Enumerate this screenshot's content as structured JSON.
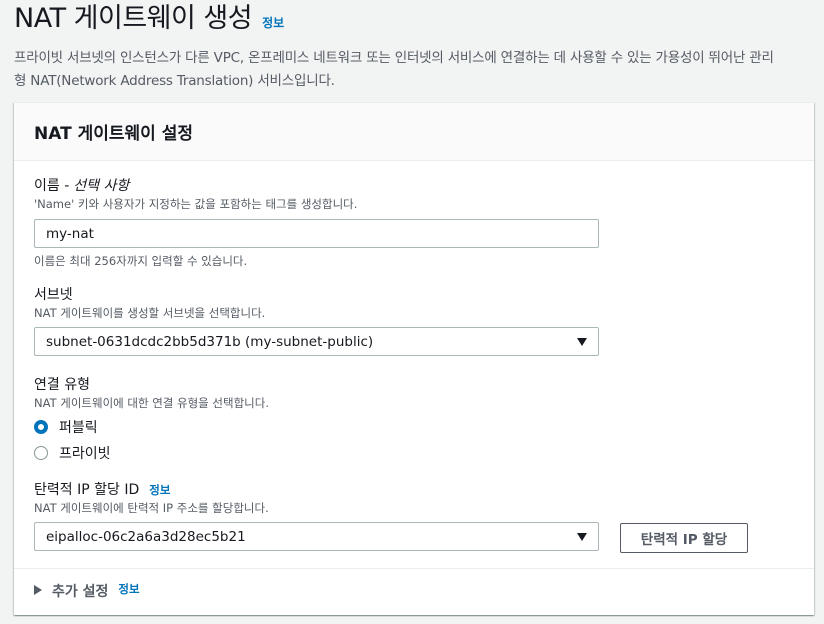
{
  "page": {
    "title": "NAT 게이트웨이 생성",
    "info": "정보",
    "description_line1": "프라이빗 서브넷의 인스턴스가 다른 VPC, 온프레미스 네트워크 또는 인터넷의 서비스에 연결하는 데 사용할 수 있는 가용성이 뛰어난 관리",
    "description_line2": "형 NAT(Network Address Translation) 서비스입니다."
  },
  "panel": {
    "title": "NAT 게이트웨이 설정"
  },
  "name_field": {
    "label": "이름 -",
    "optional": "선택 사항",
    "description": "'Name' 키와 사용자가 지정하는 값을 포함하는 태그를 생성합니다.",
    "value": "my-nat",
    "hint": "이름은 최대 256자까지 입력할 수 있습니다."
  },
  "subnet_field": {
    "label": "서브넷",
    "description": "NAT 게이트웨이를 생성할 서브넷을 선택합니다.",
    "value": "subnet-0631dcdc2bb5d371b (my-subnet-public)"
  },
  "connectivity_field": {
    "label": "연결 유형",
    "description": "NAT 게이트웨이에 대한 연결 유형을 선택합니다.",
    "options": [
      {
        "label": "퍼블릭",
        "selected": true
      },
      {
        "label": "프라이빗",
        "selected": false
      }
    ]
  },
  "eip_field": {
    "label": "탄력적 IP 할당 ID",
    "info": "정보",
    "description": "NAT 게이트웨이에 탄력적 IP 주소를 할당합니다.",
    "value": "eipalloc-06c2a6a3d28ec5b21",
    "button": "탄력적 IP 할당"
  },
  "additional_settings": {
    "label": "추가 설정",
    "info": "정보"
  },
  "colors": {
    "link": "#0073bb",
    "radio_selected": "#0073bb",
    "background": "#f2f3f3"
  }
}
